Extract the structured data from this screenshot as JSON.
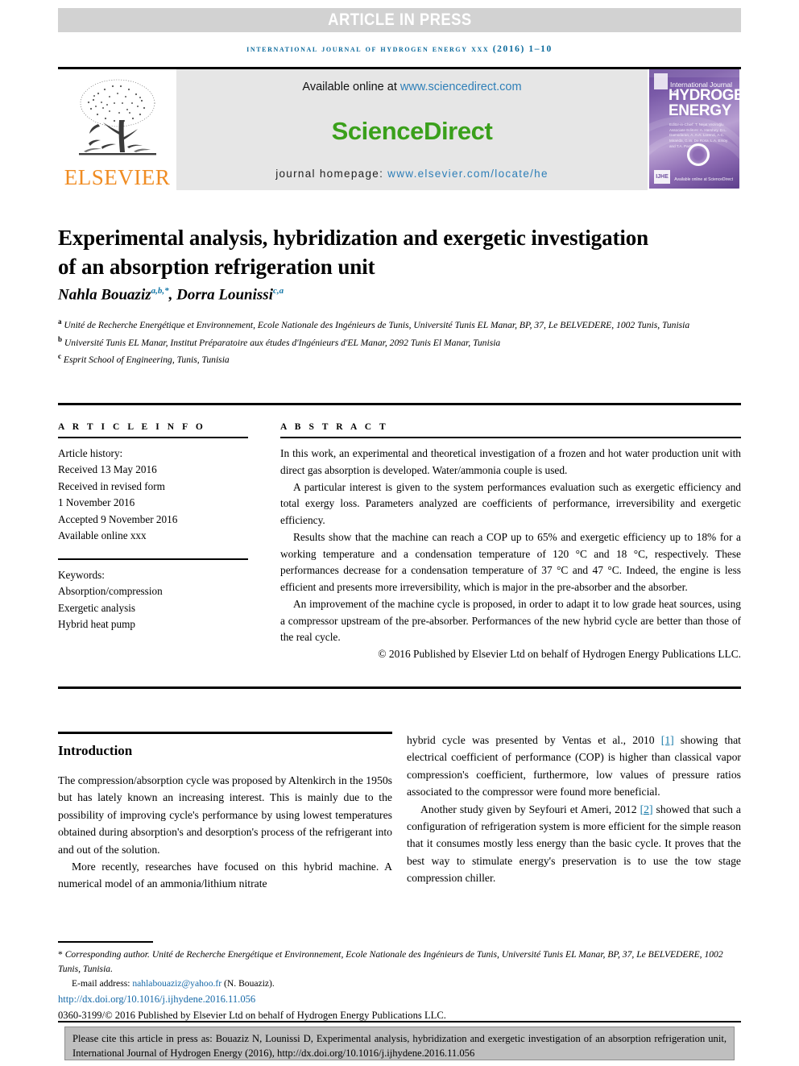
{
  "banner": {
    "article_in_press": "ARTICLE IN PRESS"
  },
  "running_head": "International Journal of Hydrogen Energy xxx (2016) 1–10",
  "masthead": {
    "publisher_name": "ELSEVIER",
    "available_prefix": "Available online at ",
    "sciencedirect_url": "www.sciencedirect.com",
    "sciencedirect_logo": "ScienceDirect",
    "homepage_prefix": "journal homepage: ",
    "homepage_url": "www.elsevier.com/locate/he",
    "cover": {
      "small_title": "International Journal of",
      "main_title_line1": "HYDROGEN",
      "main_title_line2": "ENERGY",
      "editors": "Editor-in-Chief:  T. Nejat Veziroğlu\nAssociate Editors:  A. Hershey, D.L. Damodaran, A. A-A. Lorenzi,\nA.C. Miranda, G.W. De Rosa,\nL.A. Ersoy and T.A. Panteghini",
      "badge": "IJHE",
      "sciencedirect_footer": "Available online at\nScienceDirect"
    }
  },
  "article": {
    "title": "Experimental analysis, hybridization and exergetic investigation of an absorption refrigeration unit",
    "authors": [
      {
        "name": "Nahla Bouaziz",
        "marks": "a,b,*"
      },
      {
        "name": "Dorra Lounissi",
        "marks": "c,a"
      }
    ],
    "affiliations": [
      {
        "mark": "a",
        "text": "Unité de Recherche Energétique et Environnement, Ecole Nationale des Ingénieurs de Tunis, Université Tunis EL Manar, BP, 37, Le BELVEDERE, 1002 Tunis, Tunisia"
      },
      {
        "mark": "b",
        "text": "Université Tunis EL Manar, Institut Préparatoire aux études d'Ingénieurs d'EL Manar, 2092 Tunis El Manar, Tunisia"
      },
      {
        "mark": "c",
        "text": "Esprit School of Engineering, Tunis, Tunisia"
      }
    ]
  },
  "article_info": {
    "heading": "A R T I C L E   I N F O",
    "history_label": "Article history:",
    "history": [
      "Received 13 May 2016",
      "Received in revised form",
      "1 November 2016",
      "Accepted 9 November 2016",
      "Available online xxx"
    ],
    "keywords_label": "Keywords:",
    "keywords": [
      "Absorption/compression",
      "Exergetic analysis",
      "Hybrid heat pump"
    ]
  },
  "abstract": {
    "heading": "A B S T R A C T",
    "paragraphs": [
      "In this work, an experimental and theoretical investigation of a frozen and hot water production unit with direct gas absorption is developed. Water/ammonia couple is used.",
      "A particular interest is given to the system performances evaluation such as exergetic efficiency and total exergy loss. Parameters analyzed are coefficients of performance, irreversibility and exergetic efficiency.",
      "Results show that the machine can reach a COP up to 65% and exergetic efficiency up to 18% for a working temperature and a condensation temperature of 120 °C and 18 °C, respectively. These performances decrease for a condensation temperature of 37 °C and 47 °C. Indeed, the engine is less efficient and presents more irreversibility, which is major in the pre-absorber and the absorber.",
      "An improvement of the machine cycle is proposed, in order to adapt it to low grade heat sources, using a compressor upstream of the pre-absorber. Performances of the new hybrid cycle are better than those of the real cycle."
    ],
    "copyright": "© 2016 Published by Elsevier Ltd on behalf of Hydrogen Energy Publications LLC."
  },
  "introduction": {
    "title": "Introduction",
    "left_paragraphs": [
      "The compression/absorption cycle was proposed by Altenkirch in the 1950s but has lately known an increasing interest. This is mainly due to the possibility of improving cycle's performance by using lowest temperatures obtained during absorption's and desorption's process of the refrigerant into and out of the solution.",
      "More recently, researches have focused on this hybrid machine. A numerical model of an ammonia/lithium nitrate"
    ],
    "right_paragraph_1_pre": "hybrid cycle was presented by Ventas et al., 2010 ",
    "right_paragraph_1_ref": "[1]",
    "right_paragraph_1_post": " showing that electrical coefficient of performance (COP) is higher than classical vapor compression's coefficient, furthermore, low values of pressure ratios associated to the compressor were found more beneficial.",
    "right_paragraph_2_pre": "Another study given by Seyfouri et Ameri, 2012 ",
    "right_paragraph_2_ref": "[2]",
    "right_paragraph_2_post": " showed that such a configuration of refrigeration system is more efficient for the simple reason that it consumes mostly less energy than the basic cycle. It proves that the best way to stimulate energy's preservation is to use the tow stage compression chiller."
  },
  "footnotes": {
    "corresponding_star": "*",
    "corresponding_label": " Corresponding author.",
    "corresponding_address": " Unité de Recherche Energétique et Environnement, Ecole Nationale des Ingénieurs de Tunis, Université Tunis EL Manar, BP, 37, Le BELVEDERE, 1002 Tunis, Tunisia.",
    "email_label": "E-mail address: ",
    "email": "nahlabouaziz@yahoo.fr",
    "email_owner": " (N. Bouaziz).",
    "doi": "http://dx.doi.org/10.1016/j.ijhydene.2016.11.056",
    "issn_line": "0360-3199/© 2016 Published by Elsevier Ltd on behalf of Hydrogen Energy Publications LLC."
  },
  "cite_box": {
    "text": "Please cite this article in press as: Bouaziz N, Lounissi D, Experimental analysis, hybridization and exergetic investigation of an absorption refrigeration unit, International Journal of Hydrogen Energy (2016), http://dx.doi.org/10.1016/j.ijhydene.2016.11.056"
  },
  "colors": {
    "link_blue": "#1669a8",
    "running_head_blue": "#0b6a9c",
    "elsevier_orange": "#f08c22",
    "sciencedirect_green": "#3aa01b",
    "banner_gray": "#d2d2d2",
    "sd_box_gray": "#e6e6e6",
    "cite_box_gray": "#bfbfbf"
  }
}
